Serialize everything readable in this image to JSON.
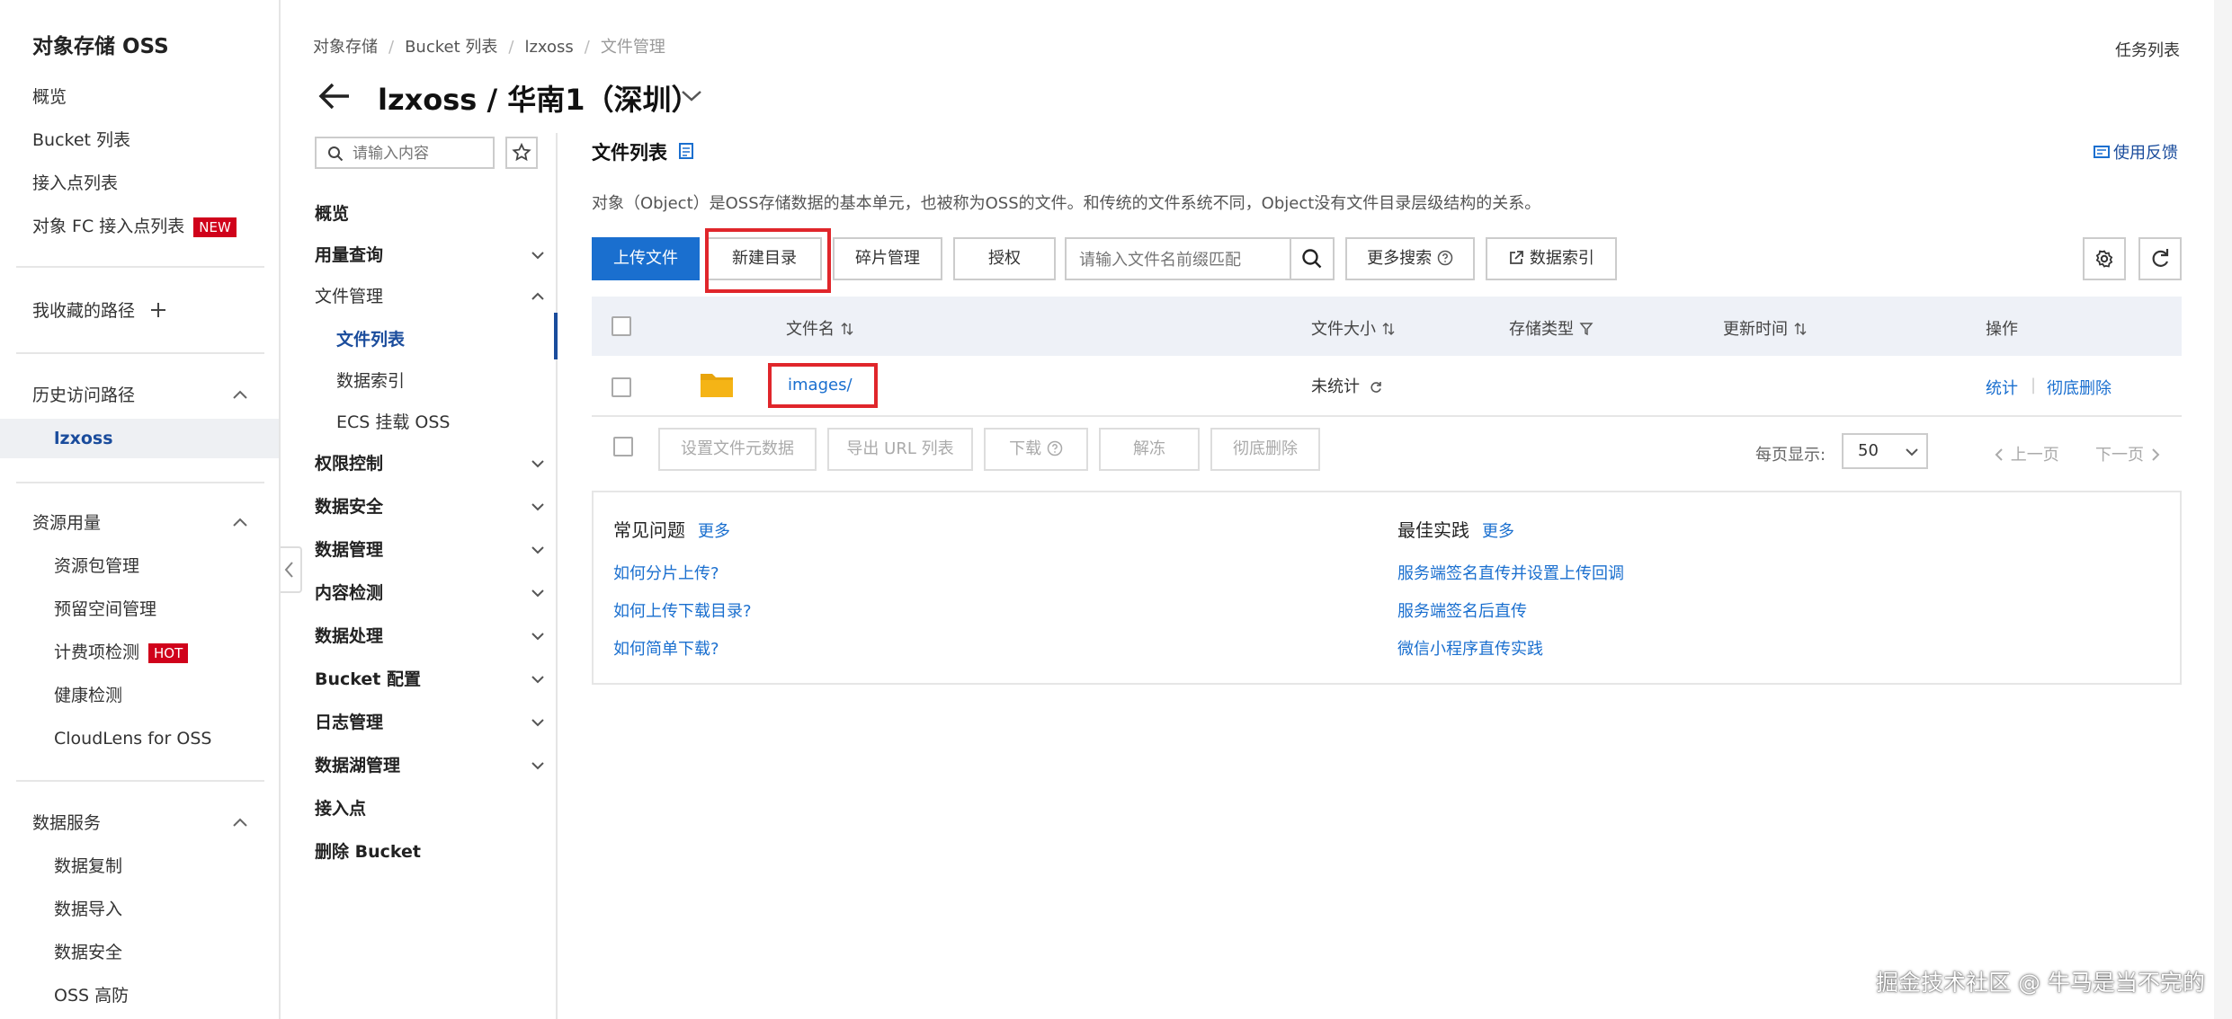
{
  "left_sidebar": {
    "title": "对象存储 OSS",
    "items": [
      "概览",
      "Bucket 列表",
      "接入点列表",
      "对象 FC 接入点列表"
    ],
    "fc_badge": "NEW",
    "favorites": "我收藏的路径",
    "history_title": "历史访问路径",
    "history_item": "lzxoss",
    "resource_title": "资源用量",
    "resource_items": [
      "资源包管理",
      "预留空间管理",
      "计费项检测",
      "健康检测",
      "CloudLens for OSS"
    ],
    "billing_badge": "HOT",
    "data_services_title": "数据服务",
    "data_services_items": [
      "数据复制",
      "数据导入",
      "数据安全",
      "OSS 高防"
    ]
  },
  "breadcrumb": [
    "对象存储",
    "Bucket 列表",
    "lzxoss",
    "文件管理"
  ],
  "task_list": "任务列表",
  "page_title": "lzxoss / 华南1（深圳）",
  "bucket_menu": {
    "search_placeholder": "请输入内容",
    "overview": "概览",
    "usage": "用量查询",
    "file_management": "文件管理",
    "file_sub": [
      "文件列表",
      "数据索引",
      "ECS 挂载 OSS"
    ],
    "sections": [
      "权限控制",
      "数据安全",
      "数据管理",
      "内容检测",
      "数据处理",
      "Bucket 配置",
      "日志管理",
      "数据湖管理"
    ],
    "access_point": "接入点",
    "delete_bucket": "删除 Bucket"
  },
  "main": {
    "title": "文件列表",
    "feedback": "使用反馈",
    "description": "对象（Object）是OSS存储数据的基本单元，也被称为OSS的文件。和传统的文件系统不同，Object没有文件目录层级结构的关系。",
    "toolbar": {
      "upload": "上传文件",
      "new_dir": "新建目录",
      "fragments": "碎片管理",
      "authorize": "授权",
      "search_placeholder": "请输入文件名前缀匹配",
      "more_search": "更多搜索",
      "data_index": "数据索引"
    },
    "table": {
      "headers": [
        "文件名",
        "文件大小",
        "存储类型",
        "更新时间",
        "操作"
      ],
      "rows": [
        {
          "name": "images/",
          "size": "未统计",
          "actions": [
            "统计",
            "彻底删除"
          ]
        }
      ]
    },
    "bulk_actions": [
      "设置文件元数据",
      "导出 URL 列表",
      "下载",
      "解冻",
      "彻底删除"
    ],
    "per_page_label": "每页显示:",
    "per_page_value": "50",
    "prev_page": "上一页",
    "next_page": "下一页",
    "help": {
      "faq_title": "常见问题",
      "faq_more": "更多",
      "faq_links": [
        "如何分片上传?",
        "如何上传下载目录?",
        "如何简单下载?"
      ],
      "best_title": "最佳实践",
      "best_more": "更多",
      "best_links": [
        "服务端签名直传并设置上传回调",
        "服务端签名后直传",
        "微信小程序直传实践"
      ]
    }
  },
  "watermark": "掘金技术社区 @ 牛马是当不完的",
  "colors": {
    "accent": "#1a6fcf",
    "highlight": "#e0262b",
    "badge": "#d0021b",
    "folder": "#f5b416"
  }
}
